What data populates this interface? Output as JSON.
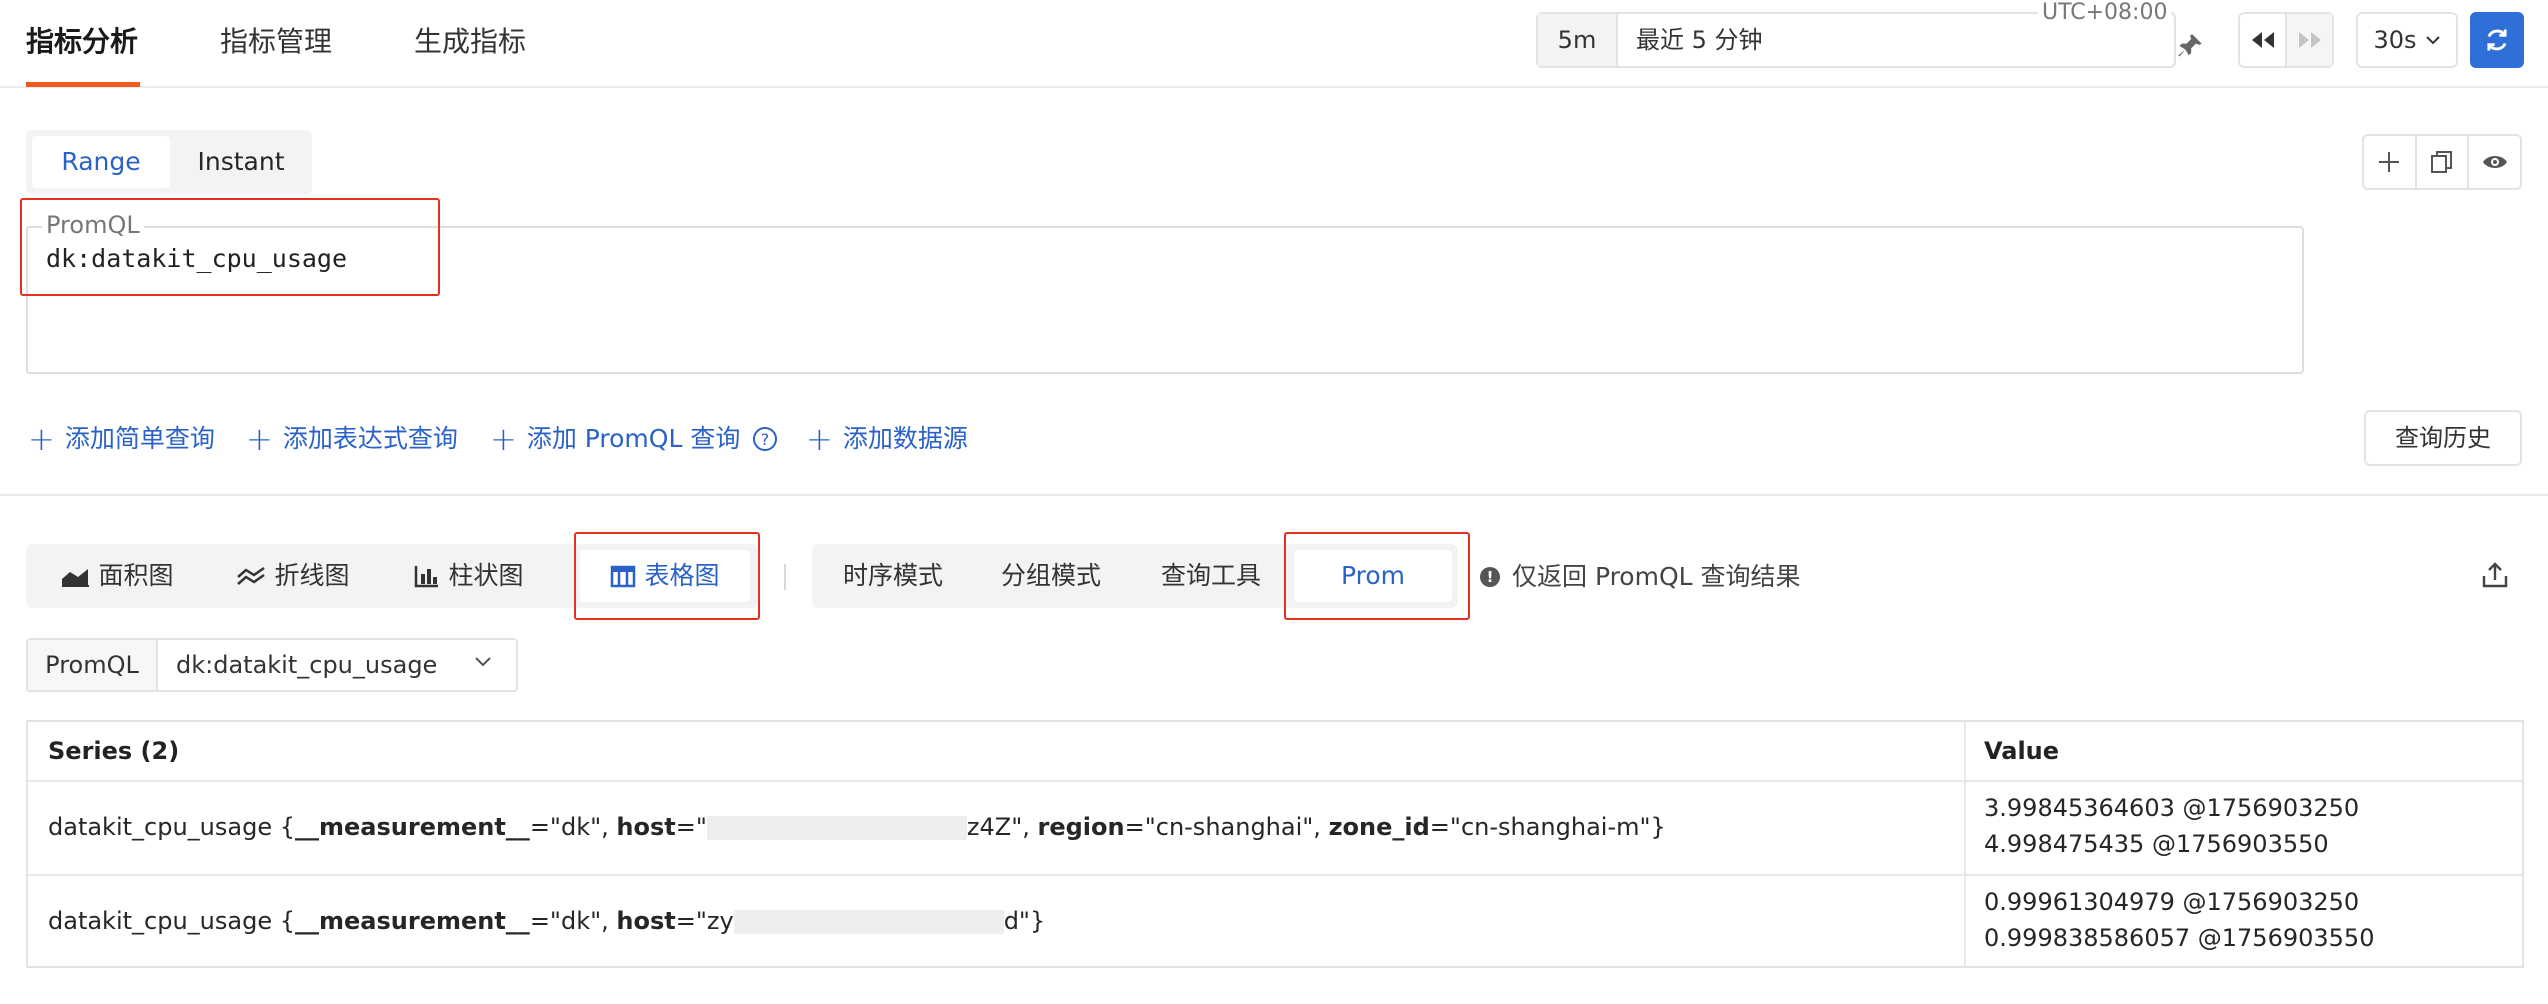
{
  "nav": {
    "tabs": [
      "指标分析",
      "指标管理",
      "生成指标"
    ]
  },
  "time": {
    "short": "5m",
    "label": "最近 5 分钟",
    "timezone": "UTC+08:00",
    "refresh": "30s"
  },
  "query": {
    "modes": [
      "Range",
      "Instant"
    ],
    "legend": "PromQL",
    "text": "dk:datakit_cpu_usage"
  },
  "add_links": [
    "添加简单查询",
    "添加表达式查询",
    "添加 PromQL 查询",
    "添加数据源"
  ],
  "history_label": "查询历史",
  "chart_types": [
    "面积图",
    "折线图",
    "柱状图",
    "表格图"
  ],
  "view_modes": [
    "时序模式",
    "分组模式",
    "查询工具",
    "Prom"
  ],
  "hint": "仅返回 PromQL 查询结果",
  "selector": {
    "label": "PromQL",
    "value": "dk:datakit_cpu_usage"
  },
  "table": {
    "headers": [
      "Series (2)",
      "Value"
    ],
    "rows": [
      {
        "metric": "datakit_cpu_usage {",
        "k1": "__measurement__",
        "v1": "=\"dk\", ",
        "k2": "host",
        "v2a": "=\"",
        "v2b": "z4Z\", ",
        "k3": "region",
        "v3": "=\"cn-shanghai\", ",
        "k4": "zone_id",
        "v4": "=\"cn-shanghai-m\"}",
        "values": [
          "3.99845364603 @1756903250",
          "4.998475435 @1756903550"
        ]
      },
      {
        "metric": "datakit_cpu_usage {",
        "k1": "__measurement__",
        "v1": "=\"dk\", ",
        "k2": "host",
        "v2a": "=\"zy",
        "v2b": "d\"}",
        "values": [
          "0.99961304979 @1756903250",
          "0.999838586057 @1756903550"
        ]
      }
    ]
  },
  "colors": {
    "accent": "#2a62c9",
    "nav_underline": "#f25a1d",
    "highlight_box": "#e5301f",
    "refresh_button": "#2f6fd8"
  }
}
